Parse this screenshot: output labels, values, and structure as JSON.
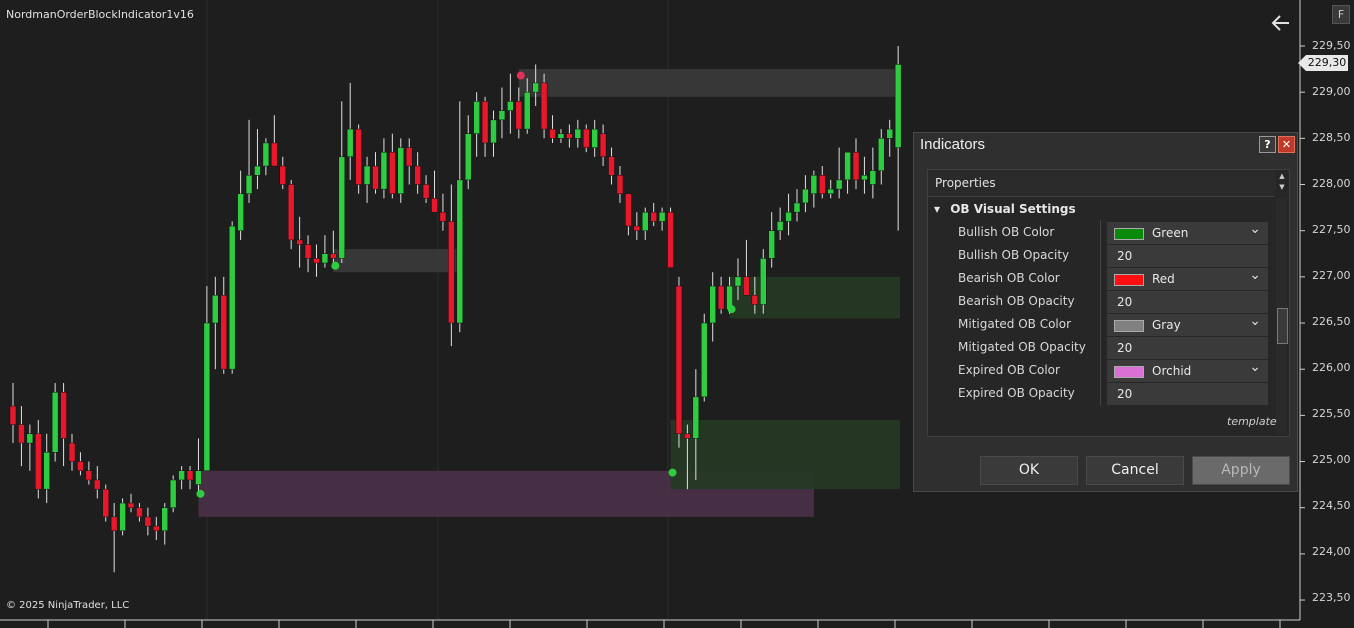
{
  "chart": {
    "indicator_name": "NordmanOrderBlockIndicator1v16",
    "copyright": "© 2025 NinjaTrader, LLC",
    "last_price": "229,30",
    "y_ticks": [
      "229,50",
      "229,00",
      "228,50",
      "228,00",
      "227,50",
      "227,00",
      "226,50",
      "226,00",
      "225,50",
      "225,00",
      "224,50",
      "224,00",
      "223,50"
    ],
    "f_button": "F",
    "colors": {
      "bull": "#2ecc40",
      "bear": "#e8172b",
      "bullish_ob": "#233a23",
      "mitigated_ob": "#3a3a3a",
      "expired_ob": "#4a3148"
    }
  },
  "chart_data": {
    "type": "candlestick",
    "y_range": [
      223.3,
      229.7
    ],
    "candles": [
      {
        "o": 225.6,
        "h": 225.85,
        "l": 225.2,
        "c": 225.4
      },
      {
        "o": 225.4,
        "h": 225.6,
        "l": 224.95,
        "c": 225.2
      },
      {
        "o": 225.2,
        "h": 225.4,
        "l": 224.9,
        "c": 225.3
      },
      {
        "o": 225.3,
        "h": 225.45,
        "l": 224.6,
        "c": 224.7
      },
      {
        "o": 224.7,
        "h": 225.3,
        "l": 224.55,
        "c": 225.1
      },
      {
        "o": 225.1,
        "h": 225.85,
        "l": 225.0,
        "c": 225.75
      },
      {
        "o": 225.75,
        "h": 225.85,
        "l": 224.95,
        "c": 225.25
      },
      {
        "o": 225.2,
        "h": 225.3,
        "l": 224.9,
        "c": 225.0
      },
      {
        "o": 225.0,
        "h": 225.1,
        "l": 224.85,
        "c": 224.9
      },
      {
        "o": 224.9,
        "h": 225.0,
        "l": 224.75,
        "c": 224.8
      },
      {
        "o": 224.8,
        "h": 224.95,
        "l": 224.6,
        "c": 224.7
      },
      {
        "o": 224.7,
        "h": 224.75,
        "l": 224.35,
        "c": 224.4
      },
      {
        "o": 224.4,
        "h": 224.55,
        "l": 223.8,
        "c": 224.25
      },
      {
        "o": 224.25,
        "h": 224.6,
        "l": 224.2,
        "c": 224.55
      },
      {
        "o": 224.55,
        "h": 224.65,
        "l": 224.45,
        "c": 224.5
      },
      {
        "o": 224.5,
        "h": 224.55,
        "l": 224.35,
        "c": 224.4
      },
      {
        "o": 224.4,
        "h": 224.5,
        "l": 224.2,
        "c": 224.3
      },
      {
        "o": 224.3,
        "h": 224.4,
        "l": 224.15,
        "c": 224.25
      },
      {
        "o": 224.25,
        "h": 224.55,
        "l": 224.1,
        "c": 224.5
      },
      {
        "o": 224.5,
        "h": 224.85,
        "l": 224.45,
        "c": 224.8
      },
      {
        "o": 224.8,
        "h": 224.95,
        "l": 224.7,
        "c": 224.9
      },
      {
        "o": 224.9,
        "h": 224.95,
        "l": 224.7,
        "c": 224.8
      },
      {
        "o": 224.75,
        "h": 225.25,
        "l": 224.65,
        "c": 224.9
      },
      {
        "o": 224.9,
        "h": 226.9,
        "l": 225.35,
        "c": 226.5
      },
      {
        "o": 226.5,
        "h": 227.0,
        "l": 226.0,
        "c": 226.8
      },
      {
        "o": 226.8,
        "h": 227.0,
        "l": 225.95,
        "c": 226.0
      },
      {
        "o": 226.0,
        "h": 227.6,
        "l": 225.95,
        "c": 227.55
      },
      {
        "o": 227.5,
        "h": 228.15,
        "l": 227.4,
        "c": 227.9
      },
      {
        "o": 227.9,
        "h": 228.7,
        "l": 227.8,
        "c": 228.1
      },
      {
        "o": 228.1,
        "h": 228.6,
        "l": 227.95,
        "c": 228.2
      },
      {
        "o": 228.2,
        "h": 228.5,
        "l": 228.1,
        "c": 228.45
      },
      {
        "o": 228.45,
        "h": 228.75,
        "l": 228.2,
        "c": 228.2
      },
      {
        "o": 228.2,
        "h": 228.3,
        "l": 227.95,
        "c": 228.0
      },
      {
        "o": 228.0,
        "h": 228.05,
        "l": 227.3,
        "c": 227.4
      },
      {
        "o": 227.4,
        "h": 227.65,
        "l": 227.1,
        "c": 227.35
      },
      {
        "o": 227.35,
        "h": 227.45,
        "l": 227.05,
        "c": 227.2
      },
      {
        "o": 227.2,
        "h": 227.35,
        "l": 227.0,
        "c": 227.15
      },
      {
        "o": 227.15,
        "h": 227.45,
        "l": 227.1,
        "c": 227.25
      },
      {
        "o": 227.25,
        "h": 227.5,
        "l": 227.15,
        "c": 227.2
      },
      {
        "o": 227.2,
        "h": 228.9,
        "l": 227.15,
        "c": 228.3
      },
      {
        "o": 228.3,
        "h": 229.1,
        "l": 228.05,
        "c": 228.6
      },
      {
        "o": 228.6,
        "h": 228.65,
        "l": 227.9,
        "c": 228.0
      },
      {
        "o": 228.0,
        "h": 228.3,
        "l": 227.8,
        "c": 228.2
      },
      {
        "o": 228.2,
        "h": 228.35,
        "l": 227.9,
        "c": 227.95
      },
      {
        "o": 227.95,
        "h": 228.5,
        "l": 227.85,
        "c": 228.35
      },
      {
        "o": 228.35,
        "h": 228.55,
        "l": 227.85,
        "c": 227.9
      },
      {
        "o": 227.9,
        "h": 228.5,
        "l": 227.8,
        "c": 228.4
      },
      {
        "o": 228.4,
        "h": 228.5,
        "l": 228.0,
        "c": 228.2
      },
      {
        "o": 228.2,
        "h": 228.35,
        "l": 227.9,
        "c": 228.0
      },
      {
        "o": 228.0,
        "h": 228.1,
        "l": 227.8,
        "c": 227.85
      },
      {
        "o": 227.85,
        "h": 228.15,
        "l": 227.7,
        "c": 227.7
      },
      {
        "o": 227.7,
        "h": 227.9,
        "l": 227.5,
        "c": 227.6
      },
      {
        "o": 227.6,
        "h": 228.0,
        "l": 226.25,
        "c": 226.5
      },
      {
        "o": 226.5,
        "h": 228.9,
        "l": 226.4,
        "c": 228.05
      },
      {
        "o": 228.05,
        "h": 228.75,
        "l": 227.95,
        "c": 228.55
      },
      {
        "o": 228.55,
        "h": 229.0,
        "l": 228.3,
        "c": 228.9
      },
      {
        "o": 228.9,
        "h": 228.95,
        "l": 228.3,
        "c": 228.45
      },
      {
        "o": 228.45,
        "h": 228.8,
        "l": 228.3,
        "c": 228.7
      },
      {
        "o": 228.7,
        "h": 229.05,
        "l": 228.5,
        "c": 228.8
      },
      {
        "o": 228.8,
        "h": 229.2,
        "l": 228.55,
        "c": 228.9
      },
      {
        "o": 228.9,
        "h": 229.05,
        "l": 228.5,
        "c": 228.6
      },
      {
        "o": 228.6,
        "h": 229.15,
        "l": 228.55,
        "c": 229.0
      },
      {
        "o": 229.0,
        "h": 229.3,
        "l": 228.85,
        "c": 229.1
      },
      {
        "o": 229.1,
        "h": 229.2,
        "l": 228.5,
        "c": 228.6
      },
      {
        "o": 228.6,
        "h": 228.75,
        "l": 228.45,
        "c": 228.5
      },
      {
        "o": 228.5,
        "h": 228.6,
        "l": 228.45,
        "c": 228.55
      },
      {
        "o": 228.55,
        "h": 228.65,
        "l": 228.4,
        "c": 228.5
      },
      {
        "o": 228.5,
        "h": 228.7,
        "l": 228.4,
        "c": 228.6
      },
      {
        "o": 228.6,
        "h": 228.65,
        "l": 228.35,
        "c": 228.4
      },
      {
        "o": 228.4,
        "h": 228.7,
        "l": 228.3,
        "c": 228.6
      },
      {
        "o": 228.55,
        "h": 228.65,
        "l": 228.2,
        "c": 228.3
      },
      {
        "o": 228.3,
        "h": 228.4,
        "l": 228.0,
        "c": 228.1
      },
      {
        "o": 228.1,
        "h": 228.2,
        "l": 227.8,
        "c": 227.9
      },
      {
        "o": 227.9,
        "h": 227.9,
        "l": 227.45,
        "c": 227.55
      },
      {
        "o": 227.55,
        "h": 227.7,
        "l": 227.4,
        "c": 227.5
      },
      {
        "o": 227.5,
        "h": 227.75,
        "l": 227.4,
        "c": 227.7
      },
      {
        "o": 227.7,
        "h": 227.8,
        "l": 227.55,
        "c": 227.6
      },
      {
        "o": 227.6,
        "h": 227.75,
        "l": 227.5,
        "c": 227.7
      },
      {
        "o": 227.7,
        "h": 227.75,
        "l": 227.1,
        "c": 227.1
      },
      {
        "o": 226.9,
        "h": 227.0,
        "l": 225.15,
        "c": 225.3
      },
      {
        "o": 225.3,
        "h": 225.4,
        "l": 224.7,
        "c": 225.25
      },
      {
        "o": 225.25,
        "h": 226.0,
        "l": 224.8,
        "c": 225.7
      },
      {
        "o": 225.7,
        "h": 226.6,
        "l": 225.65,
        "c": 226.5
      },
      {
        "o": 226.5,
        "h": 227.05,
        "l": 226.3,
        "c": 226.9
      },
      {
        "o": 226.9,
        "h": 227.0,
        "l": 226.6,
        "c": 226.65
      },
      {
        "o": 226.65,
        "h": 227.0,
        "l": 226.6,
        "c": 226.9
      },
      {
        "o": 226.9,
        "h": 227.2,
        "l": 226.75,
        "c": 227.0
      },
      {
        "o": 227.0,
        "h": 227.4,
        "l": 226.8,
        "c": 226.8
      },
      {
        "o": 226.8,
        "h": 227.0,
        "l": 226.6,
        "c": 226.7
      },
      {
        "o": 226.7,
        "h": 227.3,
        "l": 226.6,
        "c": 227.2
      },
      {
        "o": 227.2,
        "h": 227.7,
        "l": 227.1,
        "c": 227.5
      },
      {
        "o": 227.5,
        "h": 227.75,
        "l": 227.4,
        "c": 227.6
      },
      {
        "o": 227.6,
        "h": 227.9,
        "l": 227.45,
        "c": 227.7
      },
      {
        "o": 227.7,
        "h": 227.95,
        "l": 227.6,
        "c": 227.8
      },
      {
        "o": 227.8,
        "h": 228.1,
        "l": 227.7,
        "c": 227.95
      },
      {
        "o": 227.9,
        "h": 228.15,
        "l": 227.75,
        "c": 228.1
      },
      {
        "o": 228.1,
        "h": 228.2,
        "l": 227.85,
        "c": 227.9
      },
      {
        "o": 227.9,
        "h": 228.05,
        "l": 227.85,
        "c": 227.95
      },
      {
        "o": 227.95,
        "h": 228.4,
        "l": 227.85,
        "c": 228.05
      },
      {
        "o": 228.05,
        "h": 228.35,
        "l": 227.9,
        "c": 228.35
      },
      {
        "o": 228.35,
        "h": 228.5,
        "l": 227.95,
        "c": 228.05
      },
      {
        "o": 228.05,
        "h": 228.3,
        "l": 227.9,
        "c": 228.1
      },
      {
        "o": 228.0,
        "h": 228.4,
        "l": 227.85,
        "c": 228.15
      },
      {
        "o": 228.15,
        "h": 228.6,
        "l": 228.0,
        "c": 228.5
      },
      {
        "o": 228.5,
        "h": 228.7,
        "l": 228.3,
        "c": 228.6
      },
      {
        "o": 228.4,
        "h": 229.5,
        "l": 227.5,
        "c": 229.3
      }
    ],
    "order_blocks": [
      {
        "kind": "expired",
        "x0": 22,
        "x1": 95,
        "y_top": 224.9,
        "y_bot": 224.4
      },
      {
        "kind": "mitigated",
        "x0": 38,
        "x1": 53,
        "y_top": 227.3,
        "y_bot": 227.05
      },
      {
        "kind": "mitigated",
        "x0": 60,
        "x1": 105,
        "y_top": 229.25,
        "y_bot": 228.95
      },
      {
        "kind": "bullish",
        "x0": 85,
        "x1": 105,
        "y_top": 227.0,
        "y_bot": 226.55
      },
      {
        "kind": "bullish",
        "x0": 78,
        "x1": 105,
        "y_top": 225.45,
        "y_bot": 224.7
      }
    ],
    "signals": [
      {
        "i": 22,
        "y": 224.65,
        "color": "#2ecc40"
      },
      {
        "i": 38,
        "y": 227.12,
        "color": "#2ecc40"
      },
      {
        "i": 60,
        "y": 229.18,
        "color": "#e0305a"
      },
      {
        "i": 85,
        "y": 226.65,
        "color": "#2ecc40"
      },
      {
        "i": 78,
        "y": 224.88,
        "color": "#2ecc40"
      }
    ]
  },
  "dialog": {
    "title": "Indicators",
    "help": "?",
    "close": "✕",
    "properties_label": "Properties",
    "category": "OB Visual Settings",
    "rows": [
      {
        "label": "Bullish OB Color",
        "value": "Green",
        "swatch": "#0a8a0a"
      },
      {
        "label": "Bullish OB Opacity",
        "value": "20"
      },
      {
        "label": "Bearish OB Color",
        "value": "Red",
        "swatch": "#ff1010"
      },
      {
        "label": "Bearish OB Opacity",
        "value": "20"
      },
      {
        "label": "Mitigated OB Color",
        "value": "Gray",
        "swatch": "#808080"
      },
      {
        "label": "Mitigated OB Opacity",
        "value": "20"
      },
      {
        "label": "Expired OB Color",
        "value": "Orchid",
        "swatch": "#da70d6"
      },
      {
        "label": "Expired OB Opacity",
        "value": "20"
      }
    ],
    "template_link": "template",
    "ok": "OK",
    "cancel": "Cancel",
    "apply": "Apply"
  }
}
